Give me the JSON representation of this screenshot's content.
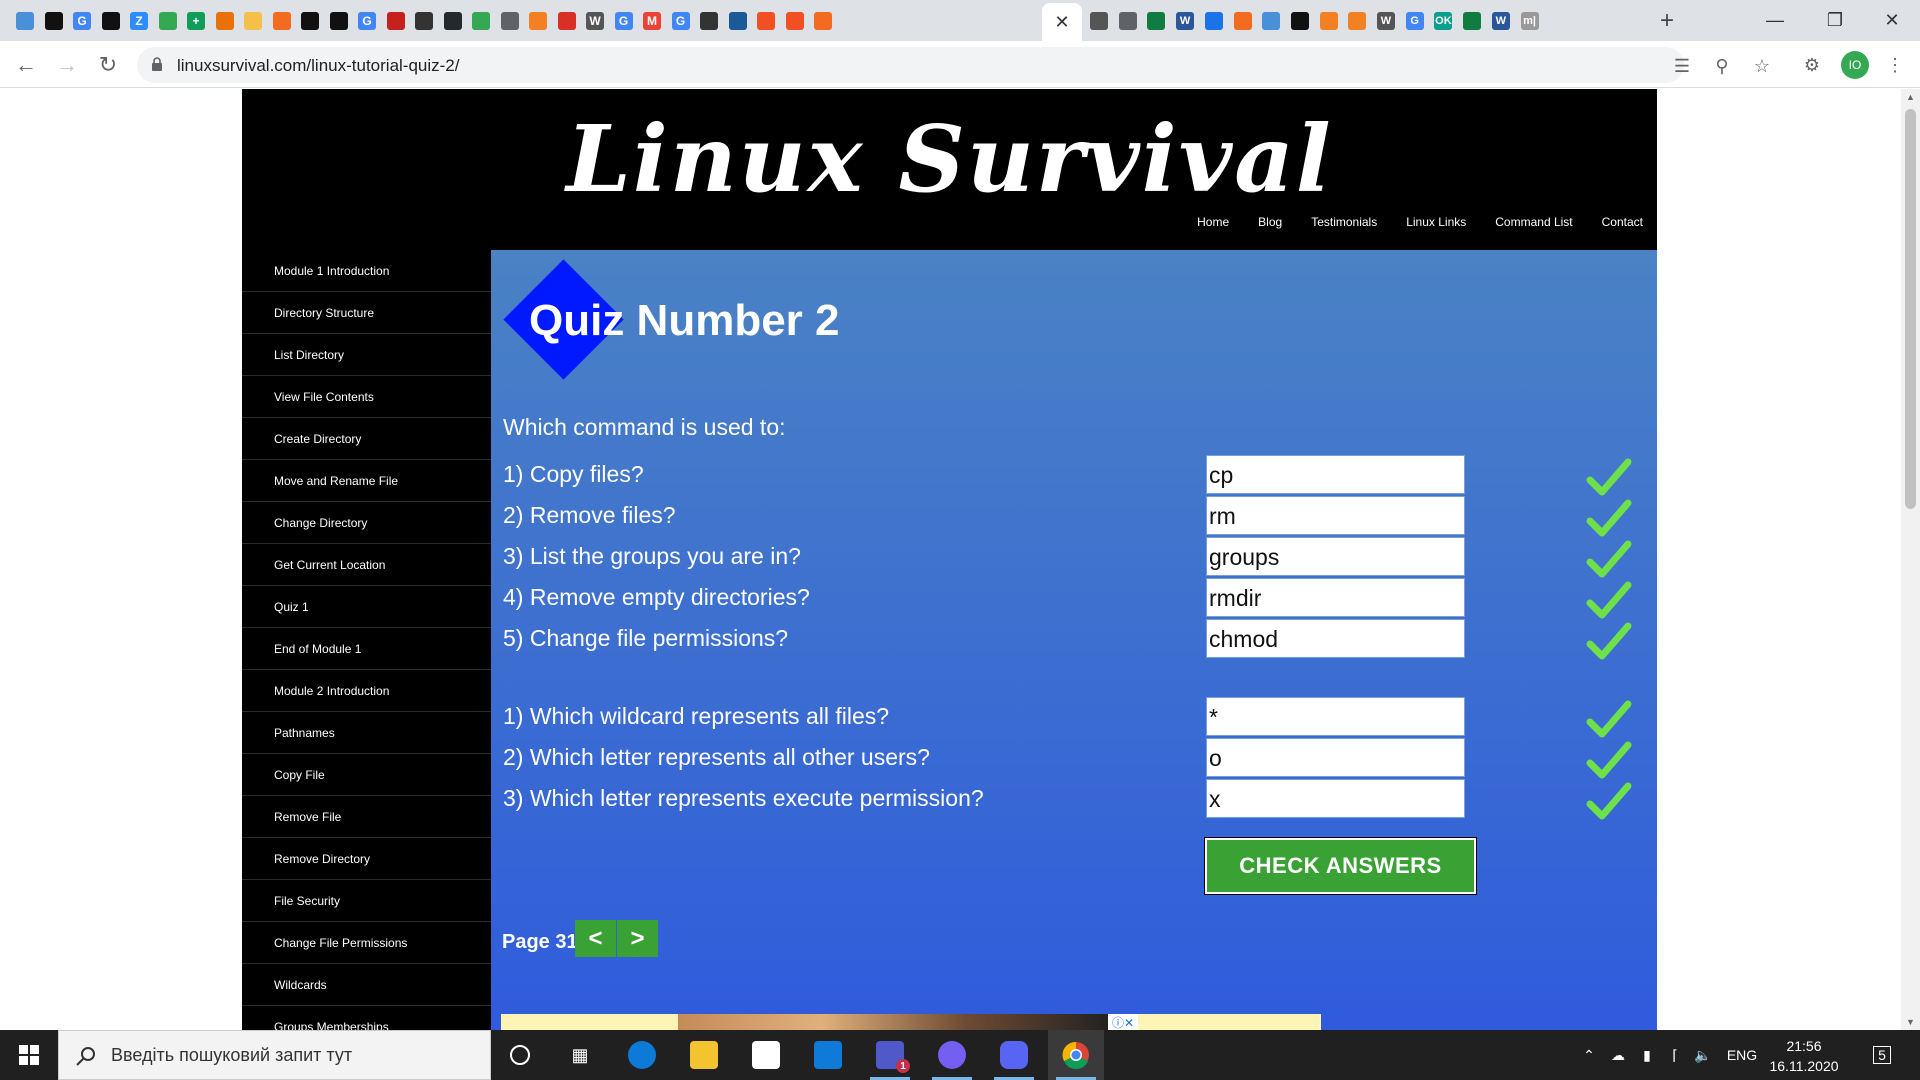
{
  "browser": {
    "tabs": [
      {
        "label": "",
        "color": "#4a90d9"
      },
      {
        "label": "",
        "color": "#111111"
      },
      {
        "label": "G",
        "color": "#4285f4"
      },
      {
        "label": "",
        "color": "#111111"
      },
      {
        "label": "Z",
        "color": "#2d8cff"
      },
      {
        "label": "",
        "color": "#34a853"
      },
      {
        "label": "+",
        "color": "#0f9d58"
      },
      {
        "label": "",
        "color": "#e8710a"
      },
      {
        "label": "",
        "color": "#f5c04a"
      },
      {
        "label": "",
        "color": "#f26b21"
      },
      {
        "label": "",
        "color": "#111111"
      },
      {
        "label": "",
        "color": "#111111"
      },
      {
        "label": "G",
        "color": "#4285f4"
      },
      {
        "label": "",
        "color": "#c5221f"
      },
      {
        "label": "",
        "color": "#333333"
      },
      {
        "label": "",
        "color": "#24292e"
      },
      {
        "label": "",
        "color": "#34a853"
      },
      {
        "label": "",
        "color": "#5f6368"
      },
      {
        "label": "",
        "color": "#f48024"
      },
      {
        "label": "",
        "color": "#d93025"
      },
      {
        "label": "W",
        "color": "#555555"
      },
      {
        "label": "G",
        "color": "#4285f4"
      },
      {
        "label": "M",
        "color": "#ea4335"
      },
      {
        "label": "G",
        "color": "#4285f4"
      },
      {
        "label": "",
        "color": "#333333"
      },
      {
        "label": "",
        "color": "#1a5a96"
      },
      {
        "label": "",
        "color": "#f25022"
      },
      {
        "label": "",
        "color": "#f25022"
      },
      {
        "label": "",
        "color": "#f26b21"
      }
    ],
    "tabs_right": [
      {
        "label": "",
        "color": "#555555"
      },
      {
        "label": "",
        "color": "#5f6368"
      },
      {
        "label": "",
        "color": "#107c41"
      },
      {
        "label": "W",
        "color": "#2b579a"
      },
      {
        "label": "",
        "color": "#1a73e8"
      },
      {
        "label": "",
        "color": "#f26b21"
      },
      {
        "label": "",
        "color": "#4a90d9"
      },
      {
        "label": "",
        "color": "#111111"
      },
      {
        "label": "",
        "color": "#f48024"
      },
      {
        "label": "",
        "color": "#f48024"
      },
      {
        "label": "W",
        "color": "#555555"
      },
      {
        "label": "G",
        "color": "#4285f4"
      },
      {
        "label": "OK",
        "color": "#0a9e8f"
      },
      {
        "label": "",
        "color": "#107c41"
      },
      {
        "label": "W",
        "color": "#2b579a"
      },
      {
        "label": "m|",
        "color": "#999999"
      }
    ],
    "active_tab_close": "✕",
    "new_tab": "+",
    "url": "linuxsurvival.com/linux-tutorial-quiz-2/",
    "profile_initials": "IO"
  },
  "site": {
    "title": "Linux Survival",
    "nav": [
      "Home",
      "Blog",
      "Testimonials",
      "Linux Links",
      "Command List",
      "Contact"
    ],
    "sidebar": [
      "Module 1 Introduction",
      "Directory Structure",
      "List Directory",
      "View File Contents",
      "Create Directory",
      "Move and Rename File",
      "Change Directory",
      "Get Current Location",
      "Quiz 1",
      "End of Module 1",
      "Module 2 Introduction",
      "Pathnames",
      "Copy File",
      "Remove File",
      "Remove Directory",
      "File Security",
      "Change File Permissions",
      "Wildcards",
      "Groups Memberships"
    ]
  },
  "quiz": {
    "title": "Quiz Number 2",
    "intro": "Which command is used to:",
    "group1": [
      {
        "question": "1) Copy files?",
        "answer": "cp",
        "correct": true
      },
      {
        "question": "2) Remove files?",
        "answer": "rm",
        "correct": true
      },
      {
        "question": "3) List the groups you are in?",
        "answer": "groups",
        "correct": true
      },
      {
        "question": "4) Remove empty directories?",
        "answer": "rmdir",
        "correct": true
      },
      {
        "question": "5) Change file permissions?",
        "answer": "chmod",
        "correct": true
      }
    ],
    "group2": [
      {
        "question": "1) Which wildcard represents all files?",
        "answer": "*",
        "correct": true
      },
      {
        "question": "2) Which letter represents all other users?",
        "answer": "o",
        "correct": true
      },
      {
        "question": "3) Which letter represents execute permission?",
        "answer": "x",
        "correct": true
      }
    ],
    "check_button": "CHECK ANSWERS",
    "page_label": "Page 31",
    "prev_button": "<",
    "next_button": ">",
    "ad_close": "ⓘ✕"
  },
  "taskbar": {
    "search_placeholder": "Введіть пошуковий запит тут",
    "language": "ENG",
    "time": "21:56",
    "date": "16.11.2020",
    "notifications_count": "5",
    "teams_badge": "1"
  }
}
